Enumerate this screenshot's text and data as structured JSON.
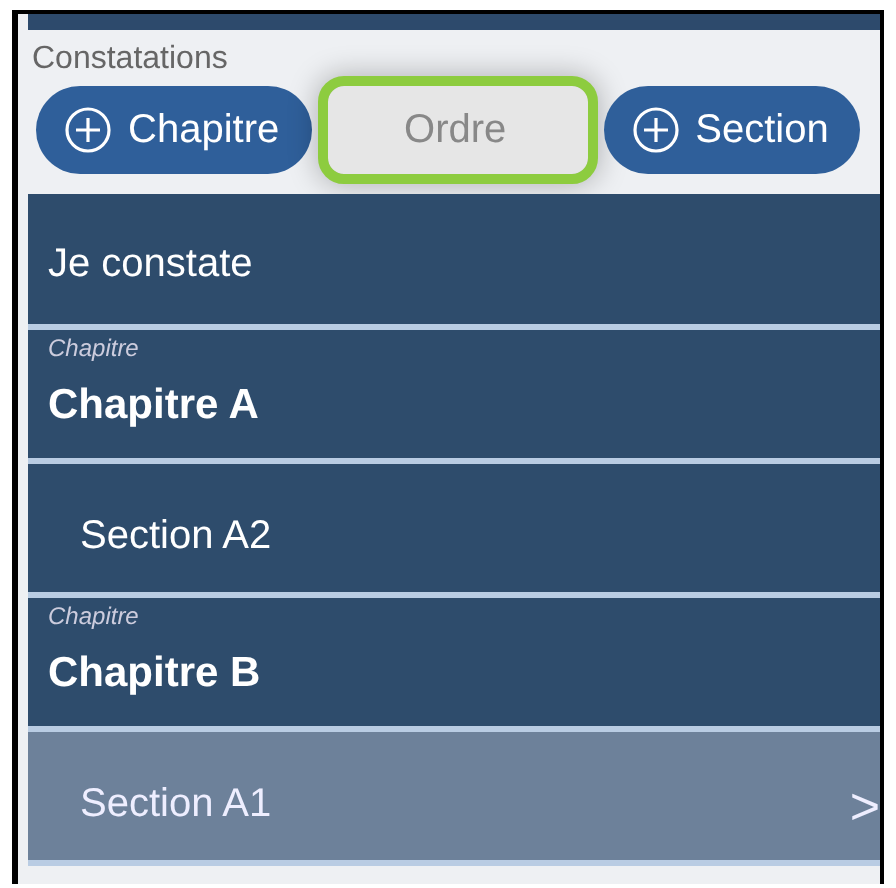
{
  "section_title": "Constatations",
  "toolbar": [
    {
      "kind": "add",
      "label": "Chapitre",
      "highlighted": false
    },
    {
      "kind": "plain",
      "label": "Ordre",
      "highlighted": true
    },
    {
      "kind": "add",
      "label": "Section",
      "highlighted": false
    }
  ],
  "rows": [
    {
      "kind": "header",
      "title": "Je constate",
      "selected": false
    },
    {
      "kind": "chapter",
      "caption": "Chapitre",
      "title": "Chapitre A",
      "selected": false
    },
    {
      "kind": "section",
      "title": "Section A2",
      "selected": false
    },
    {
      "kind": "chapter",
      "caption": "Chapitre",
      "title": "Chapitre B",
      "selected": false
    },
    {
      "kind": "section",
      "title": "Section A1",
      "selected": true,
      "chevron": ">"
    }
  ]
}
